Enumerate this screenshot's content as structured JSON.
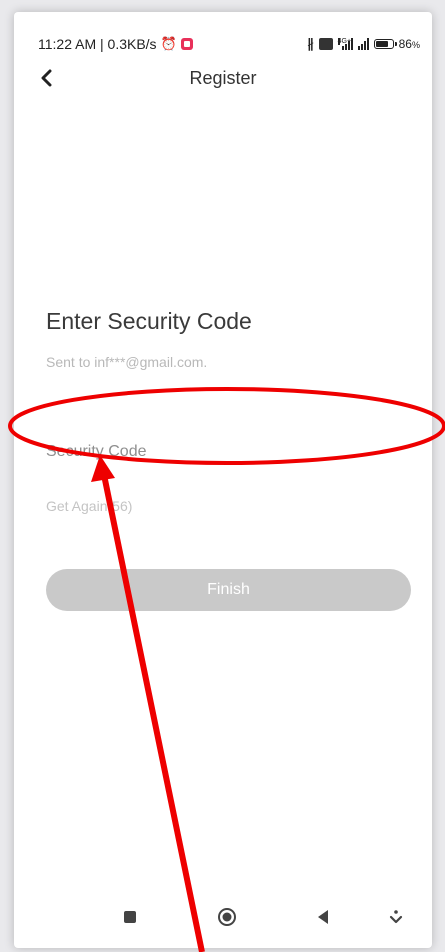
{
  "status_bar": {
    "time_data": "11:22 AM | 0.3KB/s",
    "network_type": "4G+",
    "battery": "86",
    "battery_unit": "%",
    "battery_level": 0.86
  },
  "header": {
    "title": "Register"
  },
  "form": {
    "heading": "Enter Security Code",
    "sent_to": "Sent to inf***@gmail.com.",
    "code_placeholder": "Security Code",
    "code_value": "",
    "get_again": "Get Again(56)",
    "finish_label": "Finish"
  },
  "colors": {
    "button_disabled": "#c9c9c9",
    "annotation": "#ee0000"
  },
  "icons": {
    "back": "chevron-left-icon",
    "nav_recents": "square-icon",
    "nav_home": "circle-icon",
    "nav_back": "triangle-left-icon",
    "nav_menu": "chevron-down-icon"
  }
}
